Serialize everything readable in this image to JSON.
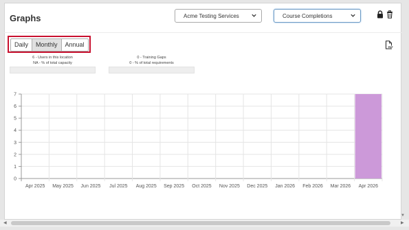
{
  "header": {
    "title": "Graphs"
  },
  "filters": {
    "location": "Acme Testing Services",
    "report": "Course Completions"
  },
  "icons": {
    "lock": "lock-icon",
    "trash": "trash-icon",
    "pdf": "pdf-export-icon",
    "chevron": "chevron-down-icon"
  },
  "period_tabs": {
    "daily": "Daily",
    "monthly": "Monthly",
    "annual": "Annual",
    "selected": "Monthly"
  },
  "stats": {
    "users_line": "6 - Users in this location",
    "capacity_line": "NA - % of total capacity",
    "gaps_line": "0 - Training Gaps",
    "requirements_line": "0 - % of total requirements"
  },
  "colors": {
    "bar": "#cc99d9",
    "highlight": "#c8102e"
  },
  "chart_data": {
    "type": "bar",
    "categories": [
      "Apr 2025",
      "May 2025",
      "Jun 2025",
      "Jul 2025",
      "Aug 2025",
      "Sep 2025",
      "Oct 2025",
      "Nov 2025",
      "Dec 2025",
      "Jan 2026",
      "Feb 2026",
      "Mar 2026",
      "Apr 2026"
    ],
    "values": [
      0,
      0,
      0,
      0,
      0,
      0,
      0,
      0,
      0,
      0,
      0,
      0,
      7
    ],
    "yticks": [
      0,
      1,
      2,
      3,
      4,
      5,
      6,
      7
    ],
    "ylim": [
      0,
      7
    ],
    "grid": true,
    "legend": "none"
  }
}
